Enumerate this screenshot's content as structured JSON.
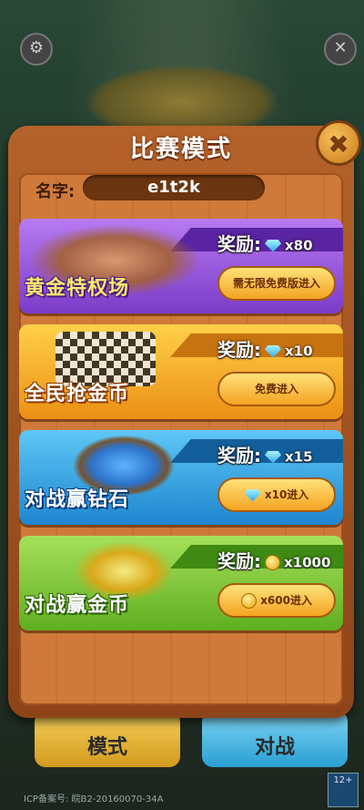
{
  "panel": {
    "title": "比赛模式",
    "name_label": "名字:",
    "name_value": "e1t2k"
  },
  "modes": [
    {
      "title": "黄金特权场",
      "reward_label": "奖励:",
      "reward_icon": "diamond-icon",
      "reward_amount": "x80",
      "button_label": "需无限免费版进入",
      "button_icon": ""
    },
    {
      "title": "全民抢金币",
      "reward_label": "奖励:",
      "reward_icon": "diamond-icon",
      "reward_amount": "x10",
      "button_label": "免费进入",
      "button_icon": ""
    },
    {
      "title": "对战赢钻石",
      "reward_label": "奖励:",
      "reward_icon": "diamond-icon",
      "reward_amount": "x15",
      "button_label": "x10进入",
      "button_icon": "diamond-icon"
    },
    {
      "title": "对战赢金币",
      "reward_label": "奖励:",
      "reward_icon": "coin-icon",
      "reward_amount": "x1000",
      "button_label": "x600进入",
      "button_icon": "coin-icon"
    }
  ],
  "background": {
    "bottom_left_label": "模式",
    "bottom_right_label": "对战",
    "icp_text": "ICP备案号: 皖B2-20160070-34A",
    "age_rating": "12+"
  },
  "colors": {
    "panel_wood": "#b4622a",
    "card_purple": "#9b5be0",
    "card_orange": "#f2a51d",
    "card_blue": "#2aa5e5",
    "card_green": "#7ac431"
  }
}
